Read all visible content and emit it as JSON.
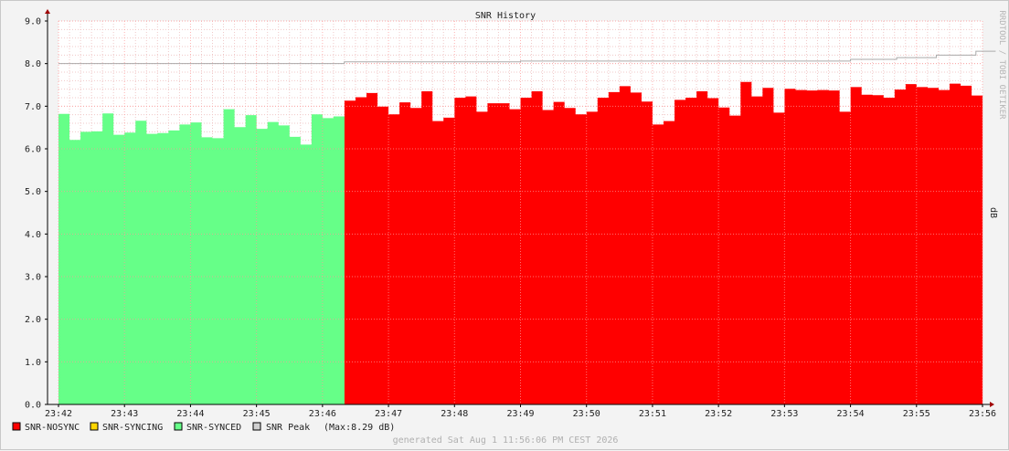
{
  "chart_data": {
    "type": "area",
    "title": "SNR History",
    "ylabel": "dB",
    "watermark": "RRDTOOL / TOBI OETIKER",
    "footer": "generated Sat Aug  1 11:56:06 PM CEST 2026",
    "ylim": [
      0,
      9
    ],
    "yticks": [
      "0.0",
      "1.0",
      "2.0",
      "3.0",
      "4.0",
      "5.0",
      "6.0",
      "7.0",
      "8.0",
      "9.0"
    ],
    "xticks": [
      "23:42",
      "23:43",
      "23:44",
      "23:45",
      "23:46",
      "23:47",
      "23:48",
      "23:49",
      "23:50",
      "23:51",
      "23:52",
      "23:53",
      "23:54",
      "23:55",
      "23:56"
    ],
    "grid": true,
    "legend_position": "bottom-left",
    "colors": {
      "nosync": "#ff0000",
      "syncing": "#ffd700",
      "synced": "#66ff88",
      "peak": "#cccccc",
      "grid": "#ff9999"
    },
    "legend": [
      {
        "label": "SNR-NOSYNC",
        "color": "#ff0000"
      },
      {
        "label": "SNR-SYNCING",
        "color": "#ffd700"
      },
      {
        "label": "SNR-SYNCED",
        "color": "#66ff88"
      },
      {
        "label": "SNR Peak",
        "color": "#d0d0d0",
        "note": "(Max:8.29 dB)"
      }
    ],
    "series": [
      {
        "name": "SNR-SYNCED",
        "color": "#66ff88",
        "x_start": 0.0,
        "step": 0.1667,
        "values": [
          6.82,
          6.21,
          6.4,
          6.41,
          6.83,
          6.33,
          6.38,
          6.66,
          6.35,
          6.37,
          6.43,
          6.57,
          6.62,
          6.27,
          6.25,
          6.93,
          6.51,
          6.79,
          6.47,
          6.63,
          6.55,
          6.28,
          6.1,
          6.81,
          6.72,
          6.76
        ]
      },
      {
        "name": "SNR-NOSYNC",
        "color": "#ff0000",
        "x_start": 4.3333,
        "step": 0.1667,
        "values": [
          7.13,
          7.21,
          7.31,
          6.99,
          6.81,
          7.09,
          6.96,
          7.35,
          6.65,
          6.73,
          7.2,
          7.23,
          6.87,
          7.07,
          7.07,
          6.93,
          7.2,
          7.35,
          6.91,
          7.1,
          6.96,
          6.81,
          6.87,
          7.2,
          7.33,
          7.47,
          7.32,
          7.11,
          6.57,
          6.65,
          7.15,
          7.2,
          7.35,
          7.19,
          6.97,
          6.78,
          7.57,
          7.23,
          7.43,
          6.85,
          7.41,
          7.38,
          7.37,
          7.38,
          7.37,
          6.87,
          7.45,
          7.27,
          7.26,
          7.2,
          7.39,
          7.52,
          7.45,
          7.43,
          7.38,
          7.53,
          7.48,
          7.25
        ]
      },
      {
        "name": "SNR Peak",
        "color": "#aaaaaa",
        "points": [
          [
            0.0,
            8.0
          ],
          [
            4.33,
            8.0
          ],
          [
            4.33,
            8.04
          ],
          [
            7.0,
            8.04
          ],
          [
            7.0,
            8.06
          ],
          [
            12.0,
            8.06
          ],
          [
            12.0,
            8.1
          ],
          [
            12.7,
            8.1
          ],
          [
            12.7,
            8.14
          ],
          [
            13.3,
            8.14
          ],
          [
            13.3,
            8.2
          ],
          [
            13.9,
            8.2
          ],
          [
            13.9,
            8.29
          ],
          [
            14.2,
            8.29
          ]
        ]
      }
    ]
  }
}
